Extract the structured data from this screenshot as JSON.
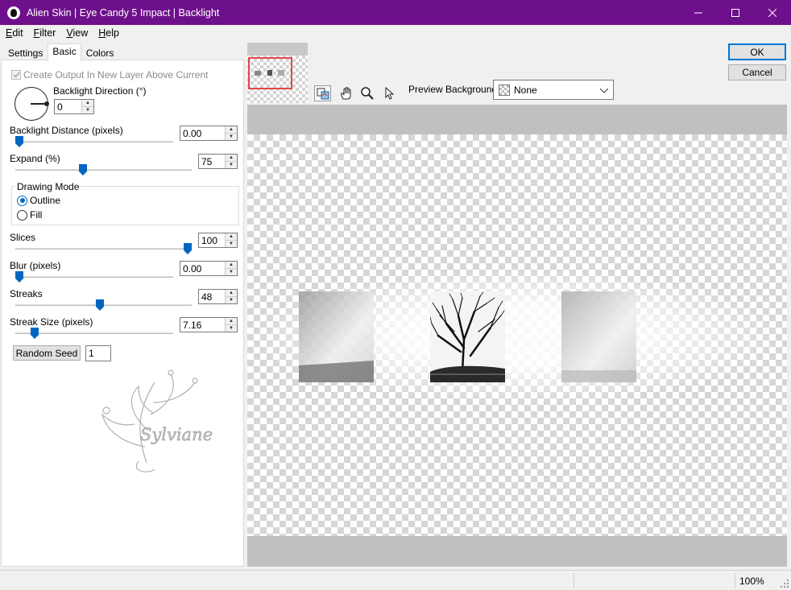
{
  "window": {
    "title": "Alien Skin | Eye Candy 5 Impact | Backlight",
    "icon": "alien-skin-logo-icon"
  },
  "menu": {
    "items": [
      {
        "key": "E",
        "rest": "dit"
      },
      {
        "key": "F",
        "rest": "ilter"
      },
      {
        "key": "V",
        "rest": "iew"
      },
      {
        "key": "H",
        "rest": "elp"
      }
    ]
  },
  "tabs": [
    "Settings",
    "Basic",
    "Colors"
  ],
  "active_tab": "Basic",
  "basic": {
    "create_output_label": "Create Output In New Layer Above Current",
    "create_output_checked": true,
    "backlight_direction_label": "Backlight Direction (°)",
    "backlight_direction_value": "0",
    "backlight_distance_label": "Backlight Distance (pixels)",
    "backlight_distance_value": "0.00",
    "expand_label": "Expand (%)",
    "expand_value": "75",
    "drawing_mode_label": "Drawing Mode",
    "drawing_mode_options": [
      "Outline",
      "Fill"
    ],
    "drawing_mode_selected": "Outline",
    "slices_label": "Slices",
    "slices_value": "100",
    "blur_label": "Blur (pixels)",
    "blur_value": "0.00",
    "streaks_label": "Streaks",
    "streaks_value": "48",
    "streak_size_label": "Streak Size (pixels)",
    "streak_size_value": "7.16",
    "random_seed_button": "Random Seed",
    "random_seed_value": "1",
    "sliders": {
      "backlight_distance": 0.0,
      "expand": 0.38,
      "slices": 1.0,
      "blur": 0.0,
      "streaks": 0.48,
      "streak_size": 0.1
    }
  },
  "watermark_text": "Sylviane",
  "buttons": {
    "ok": "OK",
    "cancel": "Cancel"
  },
  "toolbar": {
    "icons": [
      "preview-toggle-icon",
      "hand-icon",
      "zoom-icon",
      "pointer-icon"
    ],
    "preview_background_label": "Preview Background:",
    "preview_background_value": "None"
  },
  "status": {
    "zoom": "100%"
  },
  "colors": {
    "titlebar": "#6e0f8c",
    "accent": "#0067c0",
    "nav_rect": "#e04848"
  }
}
